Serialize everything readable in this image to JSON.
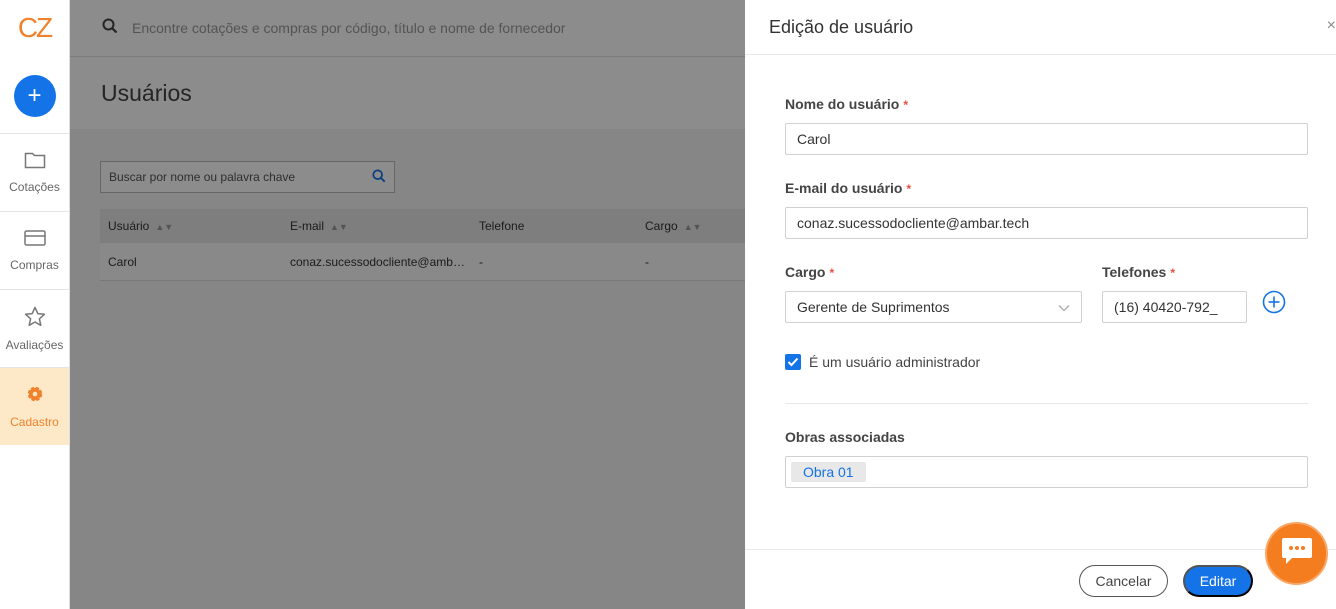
{
  "sidebar": {
    "logo": "CZ",
    "new_label": "+",
    "items": [
      {
        "label": "Cotações",
        "icon": "folder-icon"
      },
      {
        "label": "Compras",
        "icon": "card-icon"
      },
      {
        "label": "Avaliações",
        "icon": "star-icon"
      },
      {
        "label": "Cadastro",
        "icon": "gear-icon",
        "active": true
      }
    ]
  },
  "topbar": {
    "search_placeholder": "Encontre cotações e compras por código, título e nome de fornecedor"
  },
  "page": {
    "title": "Usuários",
    "search_placeholder": "Buscar por nome ou palavra chave"
  },
  "table": {
    "columns": [
      "Usuário",
      "E-mail",
      "Telefone",
      "Cargo"
    ],
    "rows": [
      [
        "Carol",
        "conaz.sucessodocliente@amb…",
        "-",
        "-"
      ]
    ]
  },
  "drawer": {
    "title": "Edição de usuário",
    "close": "×",
    "name_label": "Nome do usuário",
    "name_value": "Carol",
    "email_label": "E-mail do usuário",
    "email_value": "conaz.sucessodocliente@ambar.tech",
    "role_label": "Cargo",
    "role_value": "Gerente de Suprimentos",
    "phone_label": "Telefones",
    "phone_value": "(16) 40420-792_",
    "required_mark": "*",
    "admin_label": "É um usuário administrador",
    "admin_checked": true,
    "works_label": "Obras associadas",
    "works": [
      "Obra 01"
    ],
    "cancel_label": "Cancelar",
    "edit_label": "Editar"
  },
  "colors": {
    "primary": "#1473e6",
    "accent": "#f0822d",
    "required": "#e84c3d"
  }
}
